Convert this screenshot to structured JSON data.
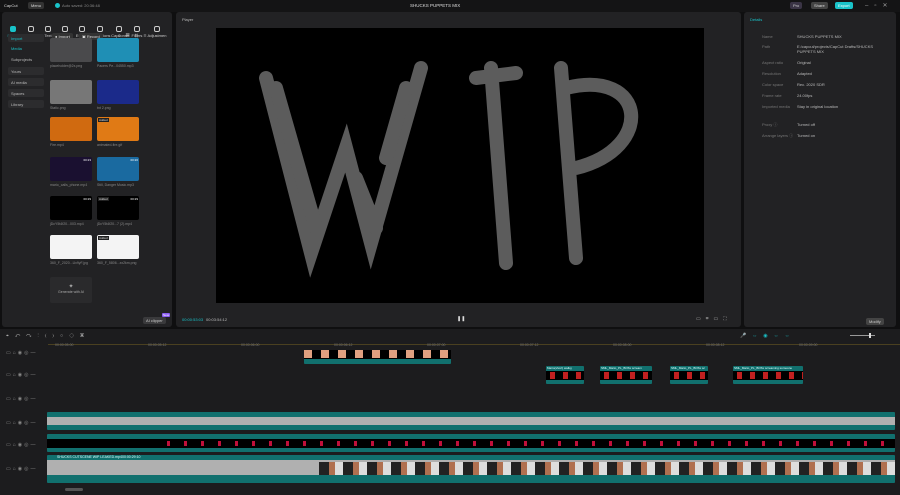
{
  "app": {
    "name": "CapCut",
    "menu": "Menu",
    "autosave": "Auto saved: 20:36:48",
    "title": "SHUCKS PUPPETS MIX",
    "pro": "Pro",
    "share": "Share",
    "export": "Export"
  },
  "tabs": [
    "Media",
    "Audio",
    "Text",
    "Stickers",
    "Effects",
    "Transitions",
    "Captions",
    "Filters",
    "Adjustmen"
  ],
  "sidebar": {
    "import": "Import",
    "media": "Media",
    "subprojects": "Subprojects",
    "items": [
      "Yours",
      "AI media",
      "Spaces",
      "Library"
    ]
  },
  "media_toolbar": {
    "import": "Import",
    "record": "Record",
    "all": "All"
  },
  "media": [
    {
      "name": "placeholder@2x.png",
      "bg": "#4a4a4c",
      "added": false,
      "duration": ""
    },
    {
      "name": "Pacers Pe...04550.mp3",
      "bg": "#1f8fb5",
      "added": false,
      "duration": ""
    },
    {
      "name": "Static.png",
      "bg": "#777",
      "added": false,
      "duration": ""
    },
    {
      "name": "tnt 2.png",
      "bg": "#1b2a8a",
      "added": false,
      "duration": ""
    },
    {
      "name": "Fire.mp4",
      "bg": "#d06a10",
      "added": false,
      "duration": ""
    },
    {
      "name": "animated-fire.gif",
      "bg": "#e07a15",
      "added": true,
      "duration": ""
    },
    {
      "name": "mario_calls_phone.mp4",
      "bg": "#1a1030",
      "added": false,
      "duration": "00:23"
    },
    {
      "name": "Still, Danger Music.mp3",
      "bg": "#1a6aa0",
      "added": false,
      "duration": "00:20"
    },
    {
      "name": "jDcY5t4f20...003.mp4",
      "bg": "#000",
      "added": false,
      "duration": "00:29"
    },
    {
      "name": "jDcY5t4f20...7 (2).mp4",
      "bg": "#000",
      "added": true,
      "duration": "00:29"
    },
    {
      "name": "360_F_2020...Ux9yF.jpg",
      "bg": "#f4f4f4",
      "added": false,
      "duration": ""
    },
    {
      "name": "360_F_5806...xx2km.png",
      "bg": "#f4f4f4",
      "added": true,
      "duration": ""
    }
  ],
  "added_label": "Added",
  "generate_ai": "Generate with AI",
  "ai_clipper": "AI clipper",
  "ai_badge": "New",
  "player": {
    "title": "Player",
    "current": "00:00:53:03",
    "total": "00:03:54:12",
    "overlay": "WIP"
  },
  "details": {
    "title": "Details",
    "rows": [
      {
        "label": "Name",
        "value": "SHUCKS PUPPETS MIX"
      },
      {
        "label": "Path",
        "value": "E:/capcut/projects/CapCut Drafts/SHUCKS PUPPETS MIX"
      },
      {
        "label": "Aspect ratio",
        "value": "Original"
      },
      {
        "label": "Resolution",
        "value": "Adapted"
      },
      {
        "label": "Color space",
        "value": "Rec. 2020 SDR"
      },
      {
        "label": "Frame rate",
        "value": "24.00fps"
      },
      {
        "label": "Imported media",
        "value": "Stay in original location"
      },
      {
        "label": "Proxy ⓘ",
        "value": "Turned off"
      },
      {
        "label": "Arrange layers ⓘ",
        "value": "Turned on"
      }
    ],
    "modify": "Modify"
  },
  "timeline": {
    "ruler": [
      "00:00:05:00",
      "00:00:05:12",
      "00:00:06:00",
      "00:00:06:12",
      "00:00:07:00",
      "00:00:07:12",
      "00:00:08:00",
      "00:00:08:12",
      "00:00:09:00"
    ],
    "clips": [
      "Mario(short) walkg",
      "SML_Mario_PL_BOSx scream",
      "SML_Mario_PL_BOSx sc",
      "SML_Mario_PL_BOSx screaming someone"
    ],
    "main_clip": "SHUCKS CUTSCENE WIP LEAKED.mp4",
    "main_dur": "00:00:29:10"
  },
  "colors": {
    "accent": "#19c3c9",
    "teal": "#11706e"
  }
}
